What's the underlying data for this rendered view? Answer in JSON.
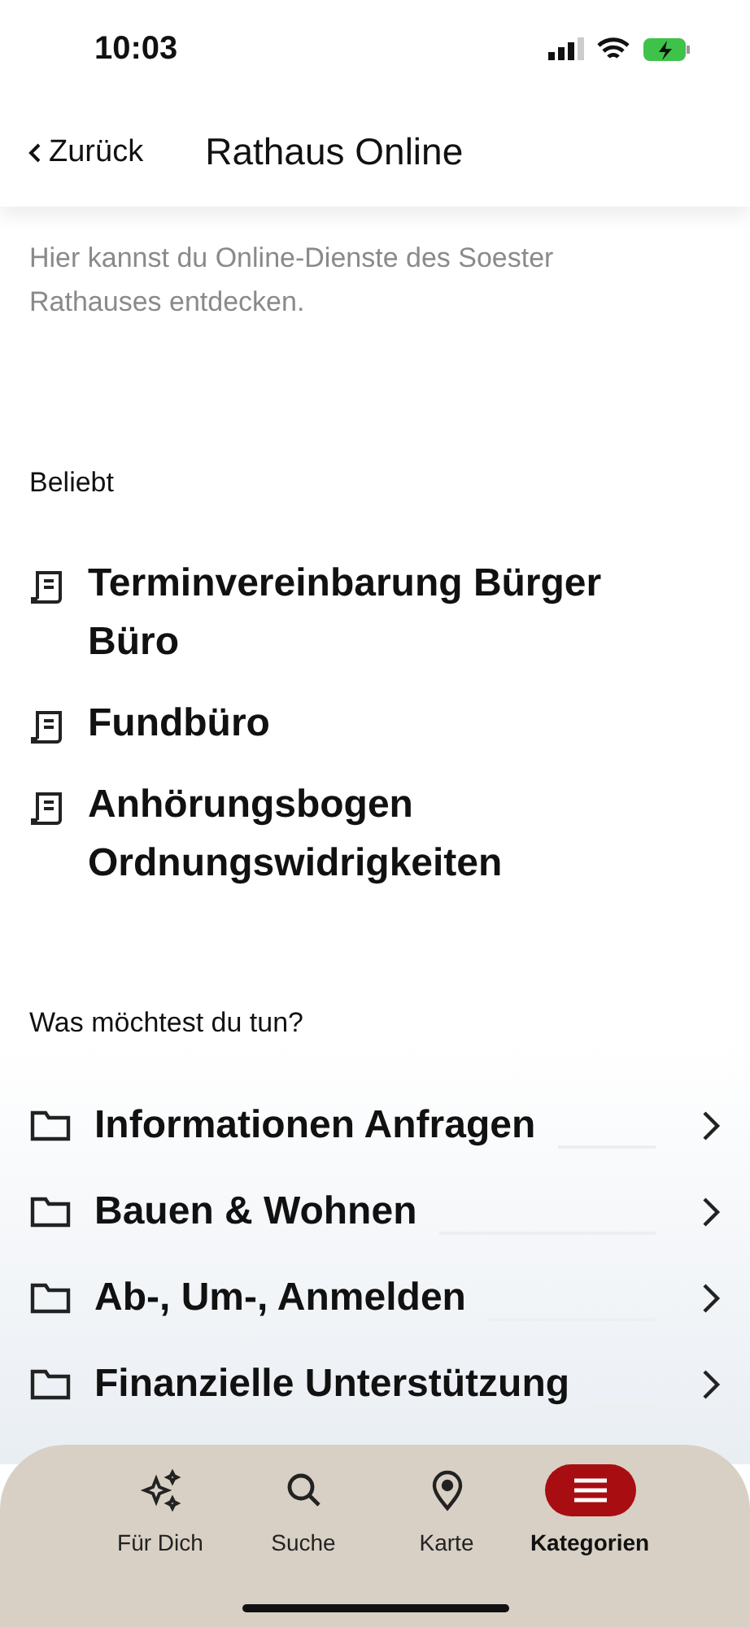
{
  "status_bar": {
    "time": "10:03"
  },
  "nav": {
    "back": "Zurück",
    "title": "Rathaus Online"
  },
  "intro": "Hier kannst du Online-Dienste des Soester Rathauses entdecken.",
  "popular": {
    "heading": "Beliebt",
    "items": [
      {
        "label": "Terminvereinbarung Bürger Büro"
      },
      {
        "label": "Fundbüro"
      },
      {
        "label": "Anhörungsbogen Ordnungswidrigkeiten"
      }
    ]
  },
  "categories": {
    "heading": "Was möchtest du tun?",
    "items": [
      {
        "label": "Informationen Anfragen"
      },
      {
        "label": "Bauen & Wohnen"
      },
      {
        "label": "Ab-, Um-, Anmelden"
      },
      {
        "label": "Finanzielle Unterstützung"
      }
    ]
  },
  "tab_bar": [
    {
      "kind": "sparkles",
      "label": "Für Dich",
      "selected": false
    },
    {
      "kind": "search",
      "label": "Suche",
      "selected": false
    },
    {
      "kind": "pin",
      "label": "Karte",
      "selected": false
    },
    {
      "kind": "menu",
      "label": "Kategorien",
      "selected": true
    }
  ]
}
